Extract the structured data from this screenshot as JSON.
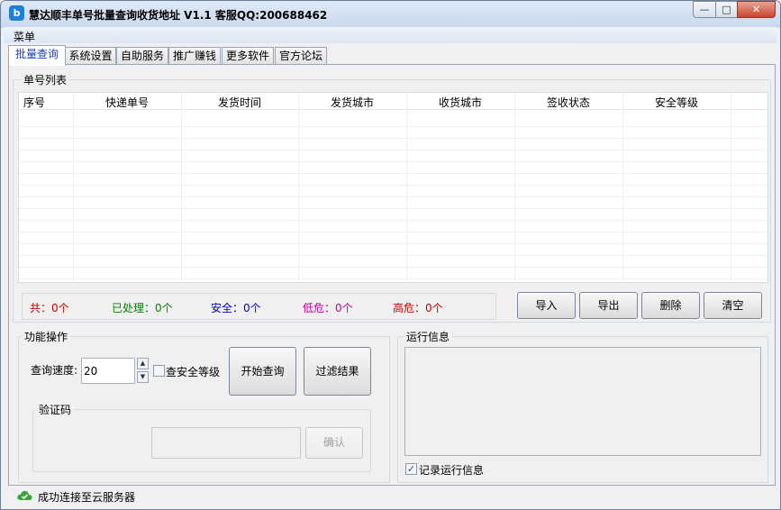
{
  "window": {
    "title": "慧达顺丰单号批量查询收货地址 V1.1 客服QQ:200688462",
    "app_icon_glyph": "b",
    "min_glyph": "—",
    "max_glyph": "□",
    "close_glyph": "✕"
  },
  "menubar": {
    "menu_label": "菜单"
  },
  "tabs": [
    {
      "label": "批量查询",
      "active": true
    },
    {
      "label": "系统设置"
    },
    {
      "label": "自助服务"
    },
    {
      "label": "推广赚钱"
    },
    {
      "label": "更多软件"
    },
    {
      "label": "官方论坛"
    }
  ],
  "list_group": {
    "title": "单号列表",
    "columns": [
      "序号",
      "快递单号",
      "发货时间",
      "发货城市",
      "收货城市",
      "签收状态",
      "安全等级"
    ],
    "rows": []
  },
  "stats": {
    "total": "共：0个",
    "processed": "已处理：0个",
    "safe": "安全：0个",
    "low_risk": "低危：0个",
    "high_risk": "高危：0个",
    "colors": {
      "total": "#c00000",
      "processed": "#008000",
      "safe": "#0000c0",
      "low_risk": "#c000a0",
      "high_risk": "#c00000"
    }
  },
  "list_buttons": {
    "import": "导入",
    "export": "导出",
    "delete": "删除",
    "clear": "清空"
  },
  "function_group": {
    "title": "功能操作",
    "speed_label": "查询速度:",
    "speed_value": "20",
    "check_security_label": "查安全等级",
    "check_security_checked": false,
    "start_button": "开始查询",
    "filter_button": "过滤结果",
    "captcha_group": {
      "title": "验证码",
      "input_value": "",
      "confirm_button": "确认"
    }
  },
  "log_group": {
    "title": "运行信息",
    "log_text": "",
    "record_log_label": "记录运行信息",
    "record_log_checked": true
  },
  "statusbar": {
    "icon": "cloud-check-icon",
    "text": "成功连接至云服务器"
  }
}
